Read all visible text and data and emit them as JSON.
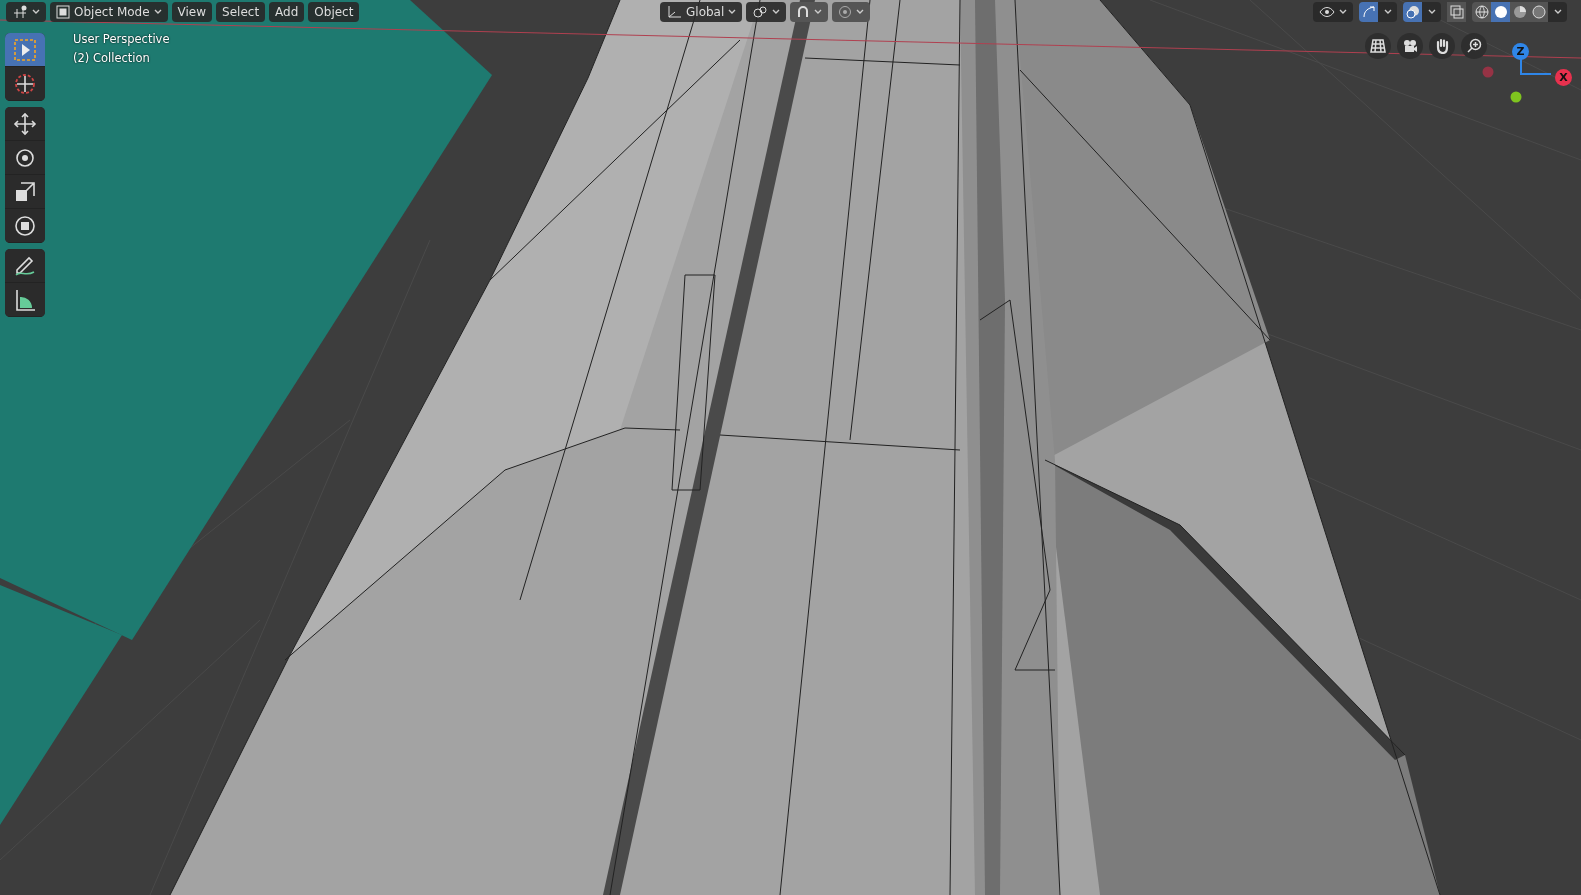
{
  "header": {
    "mode": "Object Mode",
    "menus": [
      "View",
      "Select",
      "Add",
      "Object"
    ],
    "orientation": "Global",
    "toggles": [
      {
        "kind": "snap",
        "on": false
      },
      {
        "kind": "proportional",
        "on": false
      }
    ]
  },
  "viewport_info": [
    "User Perspective",
    "(2) Collection"
  ],
  "tools": [
    {
      "kind": "select",
      "selected": true
    },
    {
      "kind": "cursor",
      "selected": false
    },
    {
      "kind": "move",
      "selected": false
    },
    {
      "kind": "rotate",
      "selected": false
    },
    {
      "kind": "scale",
      "selected": false
    },
    {
      "kind": "transform",
      "selected": false
    },
    {
      "kind": "annotate",
      "selected": false
    },
    {
      "kind": "measure",
      "selected": false
    }
  ],
  "right_header": {
    "gizmos_on": true,
    "overlays_on": true,
    "xray_on": false,
    "shading": [
      {
        "kind": "wireframe",
        "selected": false
      },
      {
        "kind": "solid",
        "selected": true
      },
      {
        "kind": "material",
        "selected": false
      },
      {
        "kind": "rendered",
        "selected": false
      }
    ]
  },
  "navigation": [
    {
      "kind": "grid"
    },
    {
      "kind": "camera"
    },
    {
      "kind": "hand"
    },
    {
      "kind": "zoom"
    }
  ],
  "axes": [
    {
      "label": "Z",
      "color": "#2f86e8"
    },
    {
      "label": "X",
      "color": "#e8314e"
    }
  ]
}
